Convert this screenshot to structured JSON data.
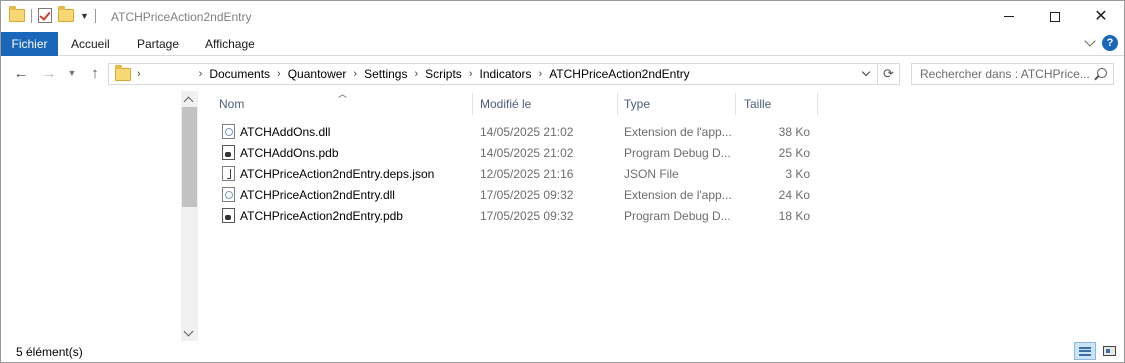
{
  "window": {
    "title": "ATCHPriceAction2ndEntry"
  },
  "ribbon": {
    "tabs": [
      "Fichier",
      "Accueil",
      "Partage",
      "Affichage"
    ],
    "help_label": "?"
  },
  "nav": {
    "back_label": "←",
    "forward_label": "→",
    "up_label": "↑",
    "breadcrumbs": [
      "Documents",
      "Quantower",
      "Settings",
      "Scripts",
      "Indicators",
      "ATCHPriceAction2ndEntry"
    ],
    "search_placeholder": "Rechercher dans : ATCHPrice..."
  },
  "columns": {
    "name": "Nom",
    "modified": "Modifié le",
    "type": "Type",
    "size": "Taille"
  },
  "files": [
    {
      "name": "ATCHAddOns.dll",
      "modified": "14/05/2025 21:02",
      "type": "Extension de l'app...",
      "size": "38 Ko",
      "icon": "dll-file-icon"
    },
    {
      "name": "ATCHAddOns.pdb",
      "modified": "14/05/2025 21:02",
      "type": "Program Debug D...",
      "size": "25 Ko",
      "icon": "pdb-file-icon"
    },
    {
      "name": "ATCHPriceAction2ndEntry.deps.json",
      "modified": "12/05/2025 21:16",
      "type": "JSON File",
      "size": "3 Ko",
      "icon": "json-file-icon"
    },
    {
      "name": "ATCHPriceAction2ndEntry.dll",
      "modified": "17/05/2025 09:32",
      "type": "Extension de l'app...",
      "size": "24 Ko",
      "icon": "dll-file-icon"
    },
    {
      "name": "ATCHPriceAction2ndEntry.pdb",
      "modified": "17/05/2025 09:32",
      "type": "Program Debug D...",
      "size": "18 Ko",
      "icon": "pdb-file-icon"
    }
  ],
  "status": {
    "item_count": "5 élément(s)"
  },
  "colors": {
    "file_tab": "#1a66b8",
    "column_header_text": "#4c607a",
    "secondary_text": "#6d6d6d"
  }
}
